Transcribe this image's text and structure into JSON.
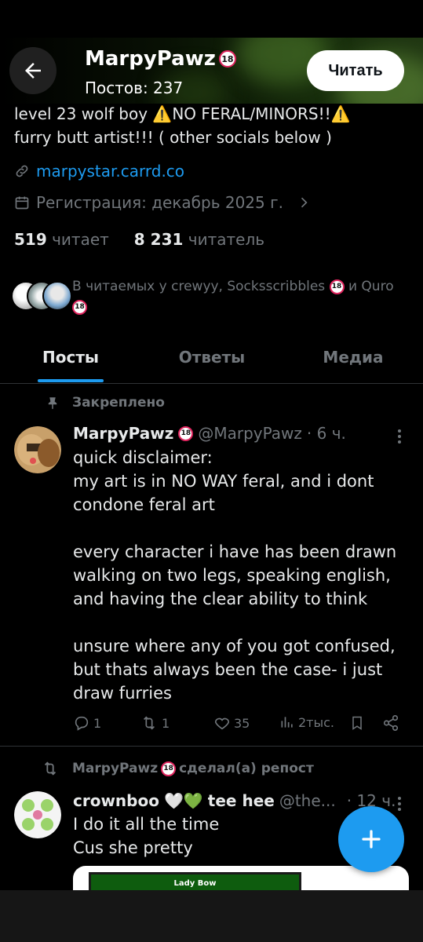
{
  "header": {
    "name": "MarpyPawz",
    "posts_count": "Постов: 237",
    "follow_label": "Читать"
  },
  "bio": {
    "line1_a": "level 23 wolf boy ",
    "line1_warn1": "⚠️",
    "line1_b": "NO FERAL/MINORS!!",
    "line1_warn2": "⚠️",
    "line2": "furry butt artist!!!  ( other socials below )"
  },
  "profile": {
    "link": "marpystar.carrd.co",
    "joined": "Регистрация: декабрь 2025 г.",
    "following_count": "519",
    "following_label": "читает",
    "followers_count": "8 231",
    "followers_label": "читатель",
    "mutuals_text_a": "В читаемых у crewyy, Socksscribbles",
    "mutuals_text_b": " и Quro"
  },
  "tabs": [
    {
      "label": "Посты",
      "active": true
    },
    {
      "label": "Ответы",
      "active": false
    },
    {
      "label": "Медиа",
      "active": false
    }
  ],
  "badge": "18",
  "pinned_tweet": {
    "pinned_label": "Закреплено",
    "name": "MarpyPawz",
    "handle": "@MarpyPawz",
    "time": "· 6 ч.",
    "lines": [
      "quick disclaimer:",
      "my art is in NO WAY feral, and i dont",
      "condone feral art",
      "",
      "every character i have has been drawn",
      "walking on two legs, speaking english,",
      "and having the clear ability to think",
      "",
      "unsure where any of you got confused,",
      "but thats always been the case- i just",
      "draw furries"
    ],
    "replies": "1",
    "reposts": "1",
    "likes": "35",
    "views": "2тыс."
  },
  "repost_tweet": {
    "repost_label": "MarpyPawz",
    "repost_suffix": "сделал(а) репост",
    "name": "crownboo",
    "name_emoji": "🤍💚",
    "name_tail": "tee hee",
    "handle": "@the...",
    "time": "· 12 ч.",
    "line1": "I do it all the time",
    "line2": "Cus she pretty",
    "card_title": "Lady Bow"
  },
  "colors": {
    "accent": "#1d9bf0",
    "muted": "#71767b",
    "text": "#e7e9ea",
    "warning": "#f4b400",
    "badge_ring": "#e0245e"
  }
}
